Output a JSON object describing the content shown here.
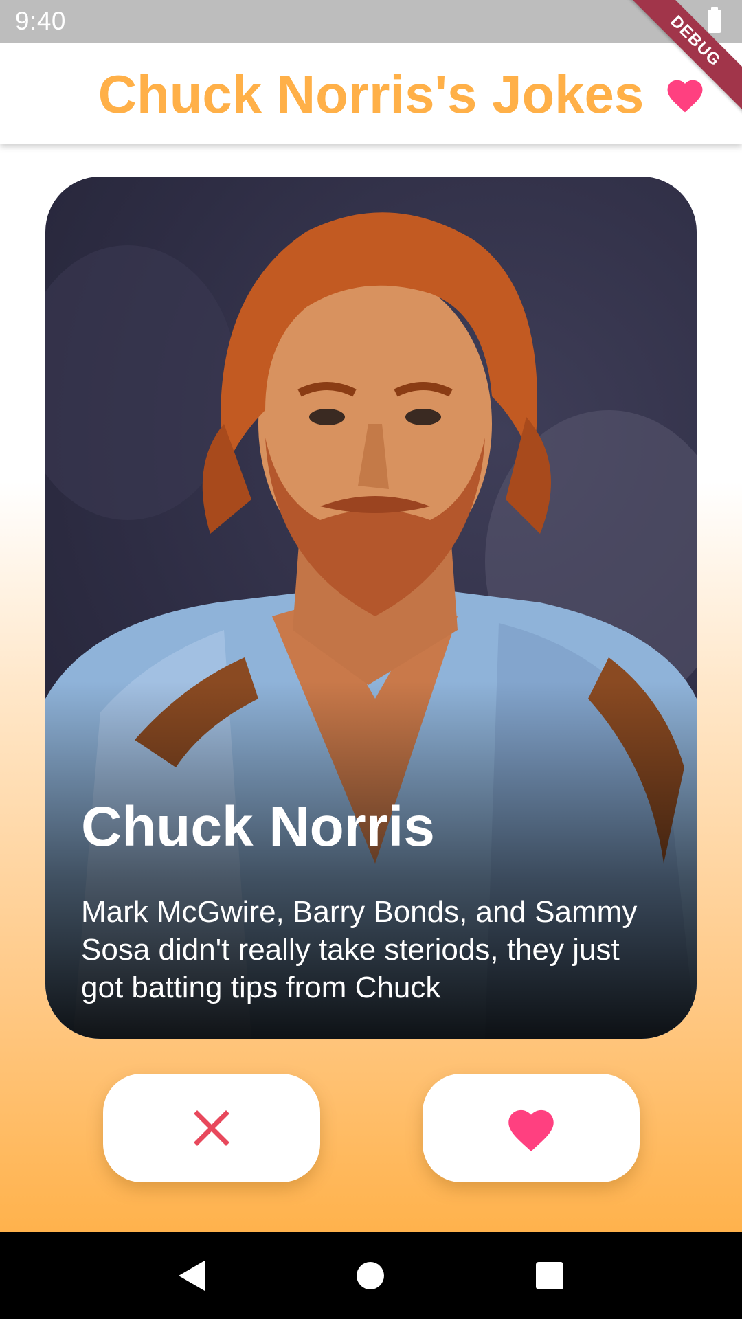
{
  "status_bar": {
    "time": "9:40"
  },
  "debug_banner": "DEBUG",
  "app_bar": {
    "title": "Chuck Norris's Jokes",
    "favorites_icon": "heart-icon"
  },
  "card": {
    "name": "Chuck Norris",
    "joke": "Mark McGwire, Barry Bonds, and Sammy Sosa didn't really take steriods, they just got batting tips from Chuck"
  },
  "actions": {
    "dislike_icon": "close-icon",
    "like_icon": "heart-icon"
  },
  "colors": {
    "accent_orange": "#ffb048",
    "heart_pink": "#ff4080",
    "close_red": "#e8485c",
    "status_bar_bg": "#bdbdbd",
    "debug_ribbon": "#a1354a"
  }
}
